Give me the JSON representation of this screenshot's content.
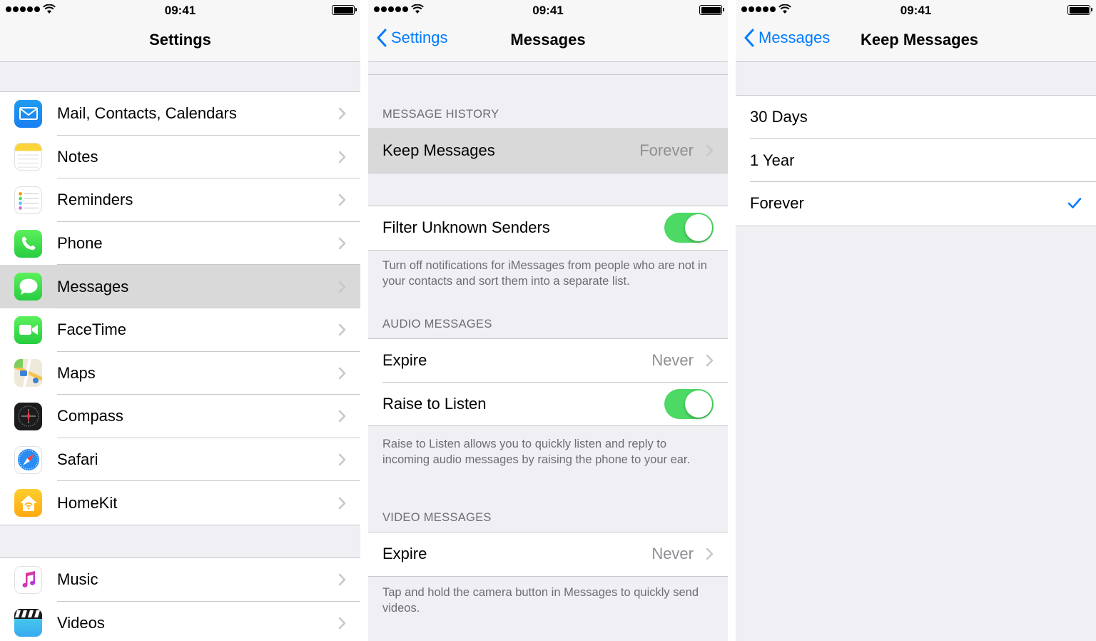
{
  "status": {
    "time": "09:41"
  },
  "screen1": {
    "title": "Settings",
    "group1": [
      {
        "label": "Mail, Contacts, Calendars",
        "icon": "mail-icon"
      },
      {
        "label": "Notes",
        "icon": "notes-icon"
      },
      {
        "label": "Reminders",
        "icon": "reminders-icon"
      },
      {
        "label": "Phone",
        "icon": "phone-icon"
      },
      {
        "label": "Messages",
        "icon": "messages-icon",
        "selected": true
      },
      {
        "label": "FaceTime",
        "icon": "facetime-icon"
      },
      {
        "label": "Maps",
        "icon": "maps-icon"
      },
      {
        "label": "Compass",
        "icon": "compass-icon"
      },
      {
        "label": "Safari",
        "icon": "safari-icon"
      },
      {
        "label": "HomeKit",
        "icon": "homekit-icon"
      }
    ],
    "group2": [
      {
        "label": "Music",
        "icon": "music-icon"
      },
      {
        "label": "Videos",
        "icon": "videos-icon"
      }
    ]
  },
  "screen2": {
    "back": "Settings",
    "title": "Messages",
    "message_history": {
      "header": "MESSAGE HISTORY",
      "keep_label": "Keep Messages",
      "keep_value": "Forever"
    },
    "filter": {
      "label": "Filter Unknown Senders",
      "on": true,
      "footer": "Turn off notifications for iMessages from people who are not in your contacts and sort them into a separate list."
    },
    "audio": {
      "header": "AUDIO MESSAGES",
      "expire_label": "Expire",
      "expire_value": "Never",
      "raise_label": "Raise to Listen",
      "raise_on": true,
      "footer": "Raise to Listen allows you to quickly listen and reply to incoming audio messages by raising the phone to your ear."
    },
    "video": {
      "header": "VIDEO MESSAGES",
      "expire_label": "Expire",
      "expire_value": "Never",
      "footer": "Tap and hold the camera button in Messages to quickly send videos."
    }
  },
  "screen3": {
    "back": "Messages",
    "title": "Keep Messages",
    "options": [
      "30 Days",
      "1 Year",
      "Forever"
    ],
    "selected": "Forever"
  },
  "colors": {
    "accent": "#007aff",
    "toggle_on": "#4cd964",
    "background": "#efeff4",
    "selected_row": "#d9d9d9"
  }
}
